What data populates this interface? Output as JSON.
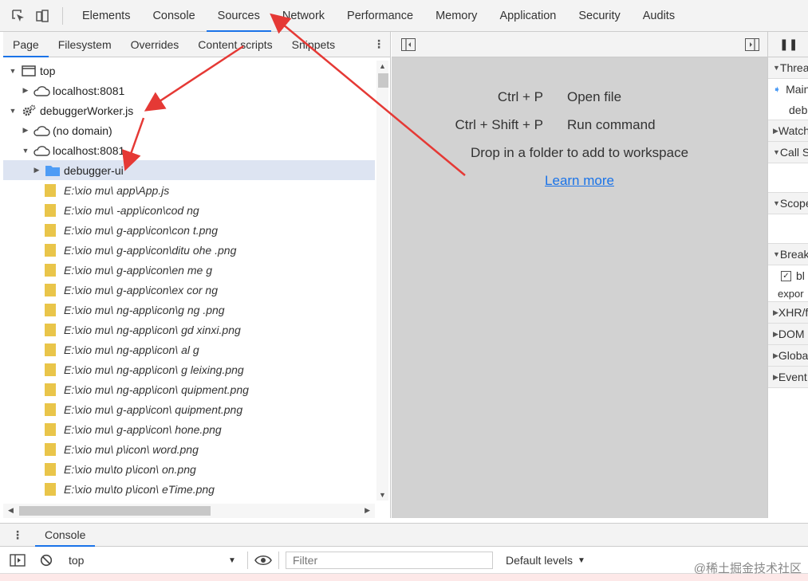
{
  "topbar": {
    "tabs": [
      "Elements",
      "Console",
      "Sources",
      "Network",
      "Performance",
      "Memory",
      "Application",
      "Security",
      "Audits"
    ],
    "active_tab": "Sources"
  },
  "navigator": {
    "tabs": [
      "Page",
      "Filesystem",
      "Overrides",
      "Content scripts",
      "Snippets"
    ],
    "active_tab": "Page",
    "tree": {
      "top": "top",
      "localhost_top": "localhost:8081",
      "worker": "debuggerWorker.js",
      "no_domain": "(no domain)",
      "localhost_worker": "localhost:8081",
      "folder": "debugger-ui",
      "files": [
        "E:\\xio   mu\\            app\\App.js",
        "E:\\xio   mu\\           -app\\icon\\cod   ng",
        "E:\\xio   mu\\          g-app\\icon\\con   t.png",
        "E:\\xio   mu\\          g-app\\icon\\ditu   ohe   .png",
        "E:\\xio   mu\\          g-app\\icon\\en   me   g",
        "E:\\xio   mu\\          g-app\\icon\\ex   cor   ng",
        "E:\\xio   mu\\          ng-app\\icon\\g   ng   .png",
        "E:\\xio   mu\\          ng-app\\icon\\   gd   xinxi.png",
        "E:\\xio   mu\\          ng-app\\icon\\   al   g",
        "E:\\xio   mu\\          ng-app\\icon\\   g   leixing.png",
        "E:\\xio   mu\\          ng-app\\icon\\   quipment.png",
        "E:\\xio   mu\\          g-app\\icon\\   quipment.png",
        "E:\\xio   mu\\          g-app\\icon\\   hone.png",
        "E:\\xio   mu\\          p\\icon\\   word.png",
        "E:\\xio   mu\\to        p\\icon\\   on.png",
        "E:\\xio   mu\\to        p\\icon\\   eTime.png"
      ]
    }
  },
  "editor_placeholder": {
    "shortcuts": [
      {
        "keys": "Ctrl + P",
        "action": "Open file"
      },
      {
        "keys": "Ctrl + Shift + P",
        "action": "Run command"
      }
    ],
    "drop_text": "Drop in a folder to add to workspace",
    "learn_more": "Learn more"
  },
  "debugger_sidebar": {
    "pause_glyph": "❚❚",
    "threads": "Threads",
    "thread_main": "Main",
    "thread_deb": "debuggerWorker.js",
    "watch": "Watch",
    "call_stack": "Call Stack",
    "scope": "Scope",
    "breakpoints": "Breakpoints",
    "breakpoint_item": "bl",
    "breakpoint_code": "expor",
    "xhr": "XHR/fetch Breakpoints",
    "dom": "DOM Breakpoints",
    "global": "Global Listeners",
    "event": "Event Listener Breakpoints"
  },
  "drawer": {
    "tab": "Console",
    "context": "top",
    "filter_placeholder": "Filter",
    "levels": "Default levels"
  },
  "watermark": "@稀土掘金技术社区",
  "colors": {
    "accent": "#1a73e8",
    "annotation": "#e53935",
    "folder": "#4e9cf5",
    "file": "#e9c54a"
  }
}
